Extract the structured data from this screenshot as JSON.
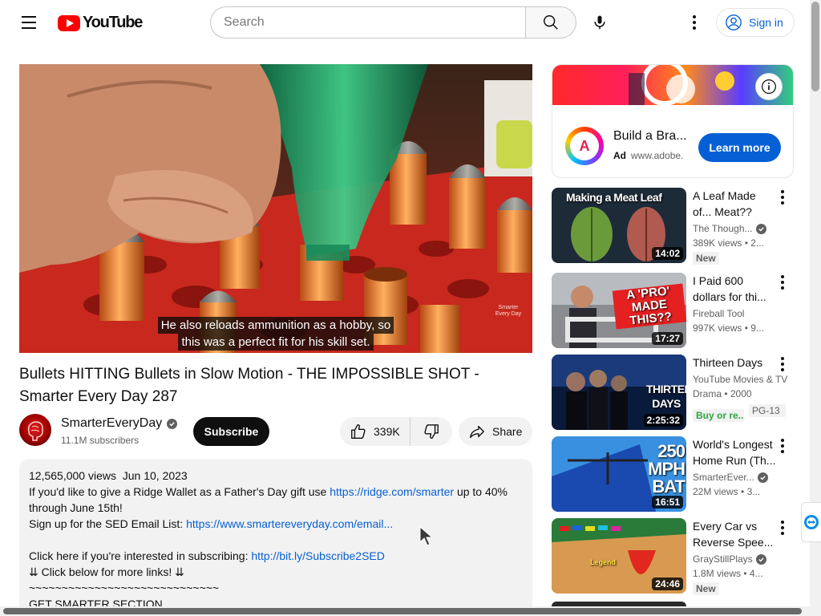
{
  "header": {
    "logo_text": "YouTube",
    "search_placeholder": "Search",
    "sign_in_label": "Sign in"
  },
  "player": {
    "caption_line1": "He also reloads ammunition as a hobby, so",
    "caption_line2": "this was a perfect fit for his skill set.",
    "watermark": "Smarter Every Day"
  },
  "video": {
    "title": "Bullets HITTING Bullets in Slow Motion - THE IMPOSSIBLE SHOT - Smarter Every Day 287",
    "channel_name": "SmarterEveryDay",
    "subscribers": "11.1M subscribers",
    "subscribe_label": "Subscribe",
    "likes": "339K",
    "share_label": "Share"
  },
  "description": {
    "views": "12,565,000 views",
    "date": "Jun 10, 2023",
    "line1_a": "If you'd like to give a Ridge Wallet as a Father's Day gift use ",
    "line1_link": "https://ridge.com/smarter",
    "line1_b": " up to 40%",
    "line2": "through June 15th!",
    "line3_a": "Sign up for the SED Email List: ",
    "line3_link": "https://www.smartereveryday.com/email...",
    "line5_a": "Click here if you're interested in subscribing: ",
    "line5_link": "http://bit.ly/Subscribe2SED",
    "line6": "⇊ Click below for more links! ⇊",
    "line7": "~~~~~~~~~~~~~~~~~~~~~~~~~~~~~",
    "line8": "GET SMARTER SECTION"
  },
  "ad": {
    "title": "Build a Bra...",
    "label": "Ad",
    "domain": "www.adobe.",
    "cta": "Learn more",
    "logo_glyph": "A"
  },
  "recommendations": [
    {
      "title": "A Leaf Made of... Meat??",
      "channel": "The Though...",
      "verified": true,
      "views": "389K views",
      "age": "2...",
      "duration": "14:02",
      "badge": "New",
      "thumb_text": "Making a Meat Leaf"
    },
    {
      "title": "I Paid 600 dollars for thi...",
      "channel": "Fireball Tool",
      "verified": false,
      "views": "997K views",
      "age": "9...",
      "duration": "17:27",
      "badge": "",
      "thumb_text": "A 'PRO' MADE THIS??"
    },
    {
      "title": "Thirteen Days",
      "channel": "YouTube Movies & TV",
      "verified": false,
      "views": "Drama • 2000",
      "age": "",
      "duration": "2:25:32",
      "badge": "",
      "thumb_text": "THIRTEEN DAYS",
      "buy_label": "Buy or re...",
      "rating": "PG-13"
    },
    {
      "title": "World's Longest Home Run (Th...",
      "channel": "SmarterEver...",
      "verified": true,
      "views": "22M views",
      "age": "3...",
      "duration": "16:51",
      "badge": "",
      "thumb_text": "250 MPH BAT"
    },
    {
      "title": "Every Car vs Reverse Spee...",
      "channel": "GrayStillPlays",
      "verified": true,
      "views": "1.8M views",
      "age": "4...",
      "duration": "24:46",
      "badge": "New",
      "thumb_text": "Legend"
    }
  ],
  "icons": {
    "menu": "hamburger-icon",
    "search": "search-icon",
    "mic": "microphone-icon",
    "more": "more-vert-icon",
    "account": "account-circle-icon",
    "like": "thumb-up-icon",
    "dislike": "thumb-down-icon",
    "share": "share-icon",
    "info": "info-icon",
    "verified": "verified-check-icon"
  },
  "colors": {
    "brand_red": "#ff0000",
    "link_blue": "#065fd4",
    "text_primary": "#0f0f0f",
    "text_secondary": "#606060",
    "chip_bg": "#f2f2f2",
    "buy_green": "#2ba640"
  }
}
